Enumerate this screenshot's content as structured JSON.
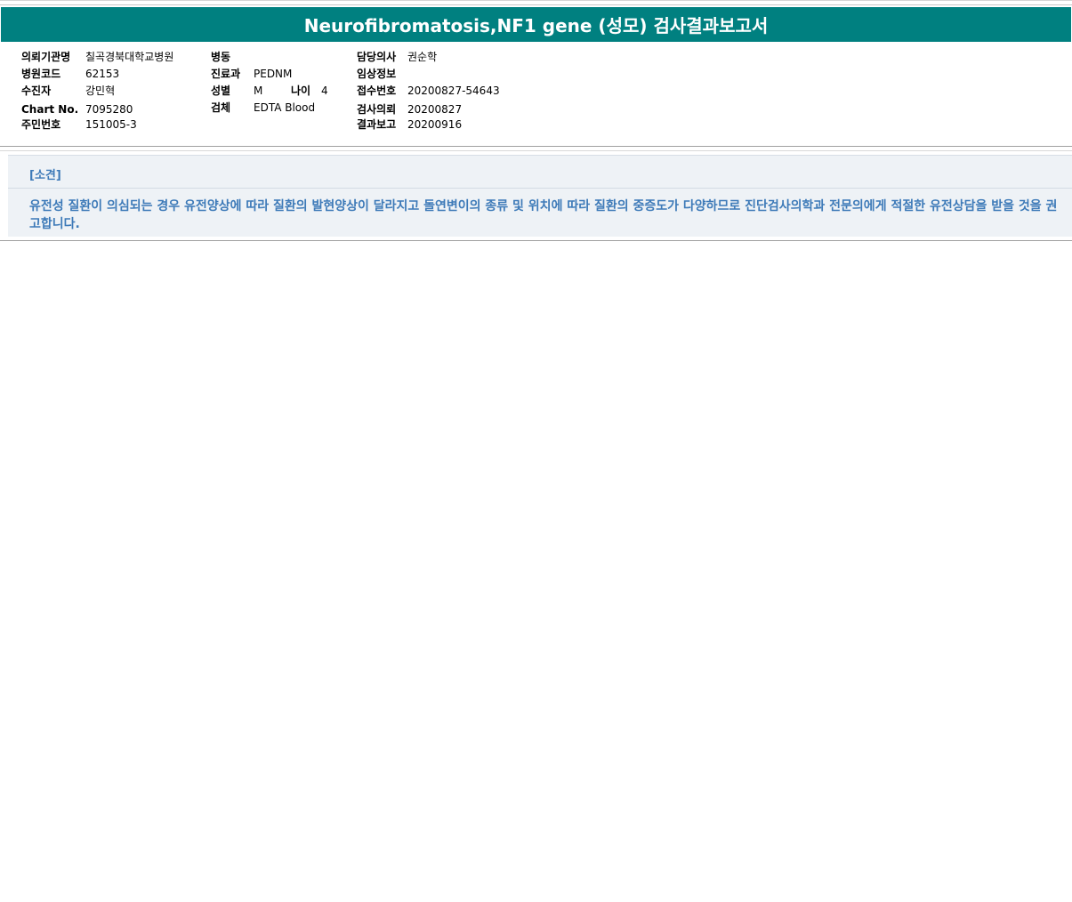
{
  "report": {
    "title": "Neurofibromatosis,NF1 gene (성모) 검사결과보고서"
  },
  "patient_info": {
    "institution": {
      "label": "의뢰기관명",
      "value": "칠곡경북대학교병원"
    },
    "hospital_code": {
      "label": "병원코드",
      "value": "62153"
    },
    "patient_name": {
      "label": "수진자",
      "value": "강민혁"
    },
    "chart_no": {
      "label": "Chart No.",
      "value": "7095280"
    },
    "resident_no": {
      "label": "주민번호",
      "value": "151005-3"
    },
    "ward": {
      "label": "병동",
      "value": ""
    },
    "department": {
      "label": "진료과",
      "value": "PEDNM"
    },
    "sex": {
      "label": "성별",
      "value": "M"
    },
    "age": {
      "label": "나이",
      "value": "4"
    },
    "specimen": {
      "label": "검체",
      "value": "EDTA Blood"
    },
    "doctor": {
      "label": "담당의사",
      "value": "권순학"
    },
    "clinical_info": {
      "label": "임상정보",
      "value": ""
    },
    "receipt_no": {
      "label": "접수번호",
      "value": "20200827-54643"
    },
    "request_date": {
      "label": "검사의뢰",
      "value": "20200827"
    },
    "report_date": {
      "label": "결과보고",
      "value": "20200916"
    }
  },
  "opinion": {
    "title": "[소견]",
    "text": "유전성 질환이 의심되는 경우 유전양상에 따라 질환의 발현양상이 달라지고 돌연변이의 종류 및 위치에 따라 질환의 중증도가 다양하므로 진단검사의학과 전문의에게 적절한 유전상담을 받을 것을 권고합니다."
  }
}
